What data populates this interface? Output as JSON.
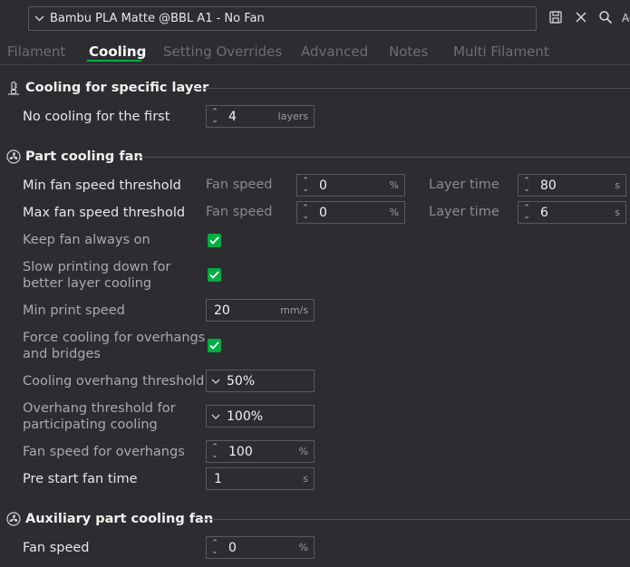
{
  "header": {
    "preset_name": "Bambu PLA Matte @BBL A1 - No Fan",
    "overflow_text": "Ac"
  },
  "tabs": [
    {
      "label": "Filament"
    },
    {
      "label": "Cooling"
    },
    {
      "label": "Setting Overrides"
    },
    {
      "label": "Advanced"
    },
    {
      "label": "Notes"
    },
    {
      "label": "Multi Filament"
    }
  ],
  "sections": {
    "layer": {
      "title": "Cooling for specific layer",
      "no_cooling": {
        "label": "No cooling for the first",
        "value": "4",
        "unit": "layers"
      }
    },
    "part_fan": {
      "title": "Part cooling fan",
      "fan_speed_label": "Fan speed",
      "layer_time_label": "Layer time",
      "min_threshold": {
        "label": "Min fan speed threshold",
        "fan_value": "0",
        "fan_unit": "%",
        "time_value": "80",
        "time_unit": "s"
      },
      "max_threshold": {
        "label": "Max fan speed threshold",
        "fan_value": "0",
        "fan_unit": "%",
        "time_value": "6",
        "time_unit": "s"
      },
      "keep_fan_on": {
        "label": "Keep fan always on",
        "checked": true
      },
      "slow_down": {
        "label_line1": "Slow printing down for",
        "label_line2": "better layer cooling",
        "checked": true
      },
      "min_print_speed": {
        "label": "Min print speed",
        "value": "20",
        "unit": "mm/s"
      },
      "force_cooling": {
        "label_line1": "Force cooling for overhangs",
        "label_line2": "and bridges",
        "checked": true
      },
      "overhang_threshold": {
        "label": "Cooling overhang threshold",
        "value": "50%"
      },
      "participating_threshold": {
        "label_line1": "Overhang threshold for",
        "label_line2": "participating cooling",
        "value": "100%"
      },
      "fan_overhangs": {
        "label": "Fan speed for overhangs",
        "value": "100",
        "unit": "%"
      },
      "pre_start": {
        "label": "Pre start fan time",
        "value": "1",
        "unit": "s"
      }
    },
    "aux_fan": {
      "title": "Auxiliary part cooling fan",
      "fan_speed": {
        "label": "Fan speed",
        "value": "0",
        "unit": "%"
      }
    }
  },
  "colors": {
    "background": "#2d2d31",
    "accent": "#00ae42",
    "border": "#5a5a5e"
  },
  "icons": {
    "chevron": "chevron-down-icon",
    "save": "save-icon",
    "close": "close-icon",
    "search": "search-icon",
    "thermometer": "thermometer-icon",
    "fan": "fan-icon",
    "check": "check-icon"
  }
}
